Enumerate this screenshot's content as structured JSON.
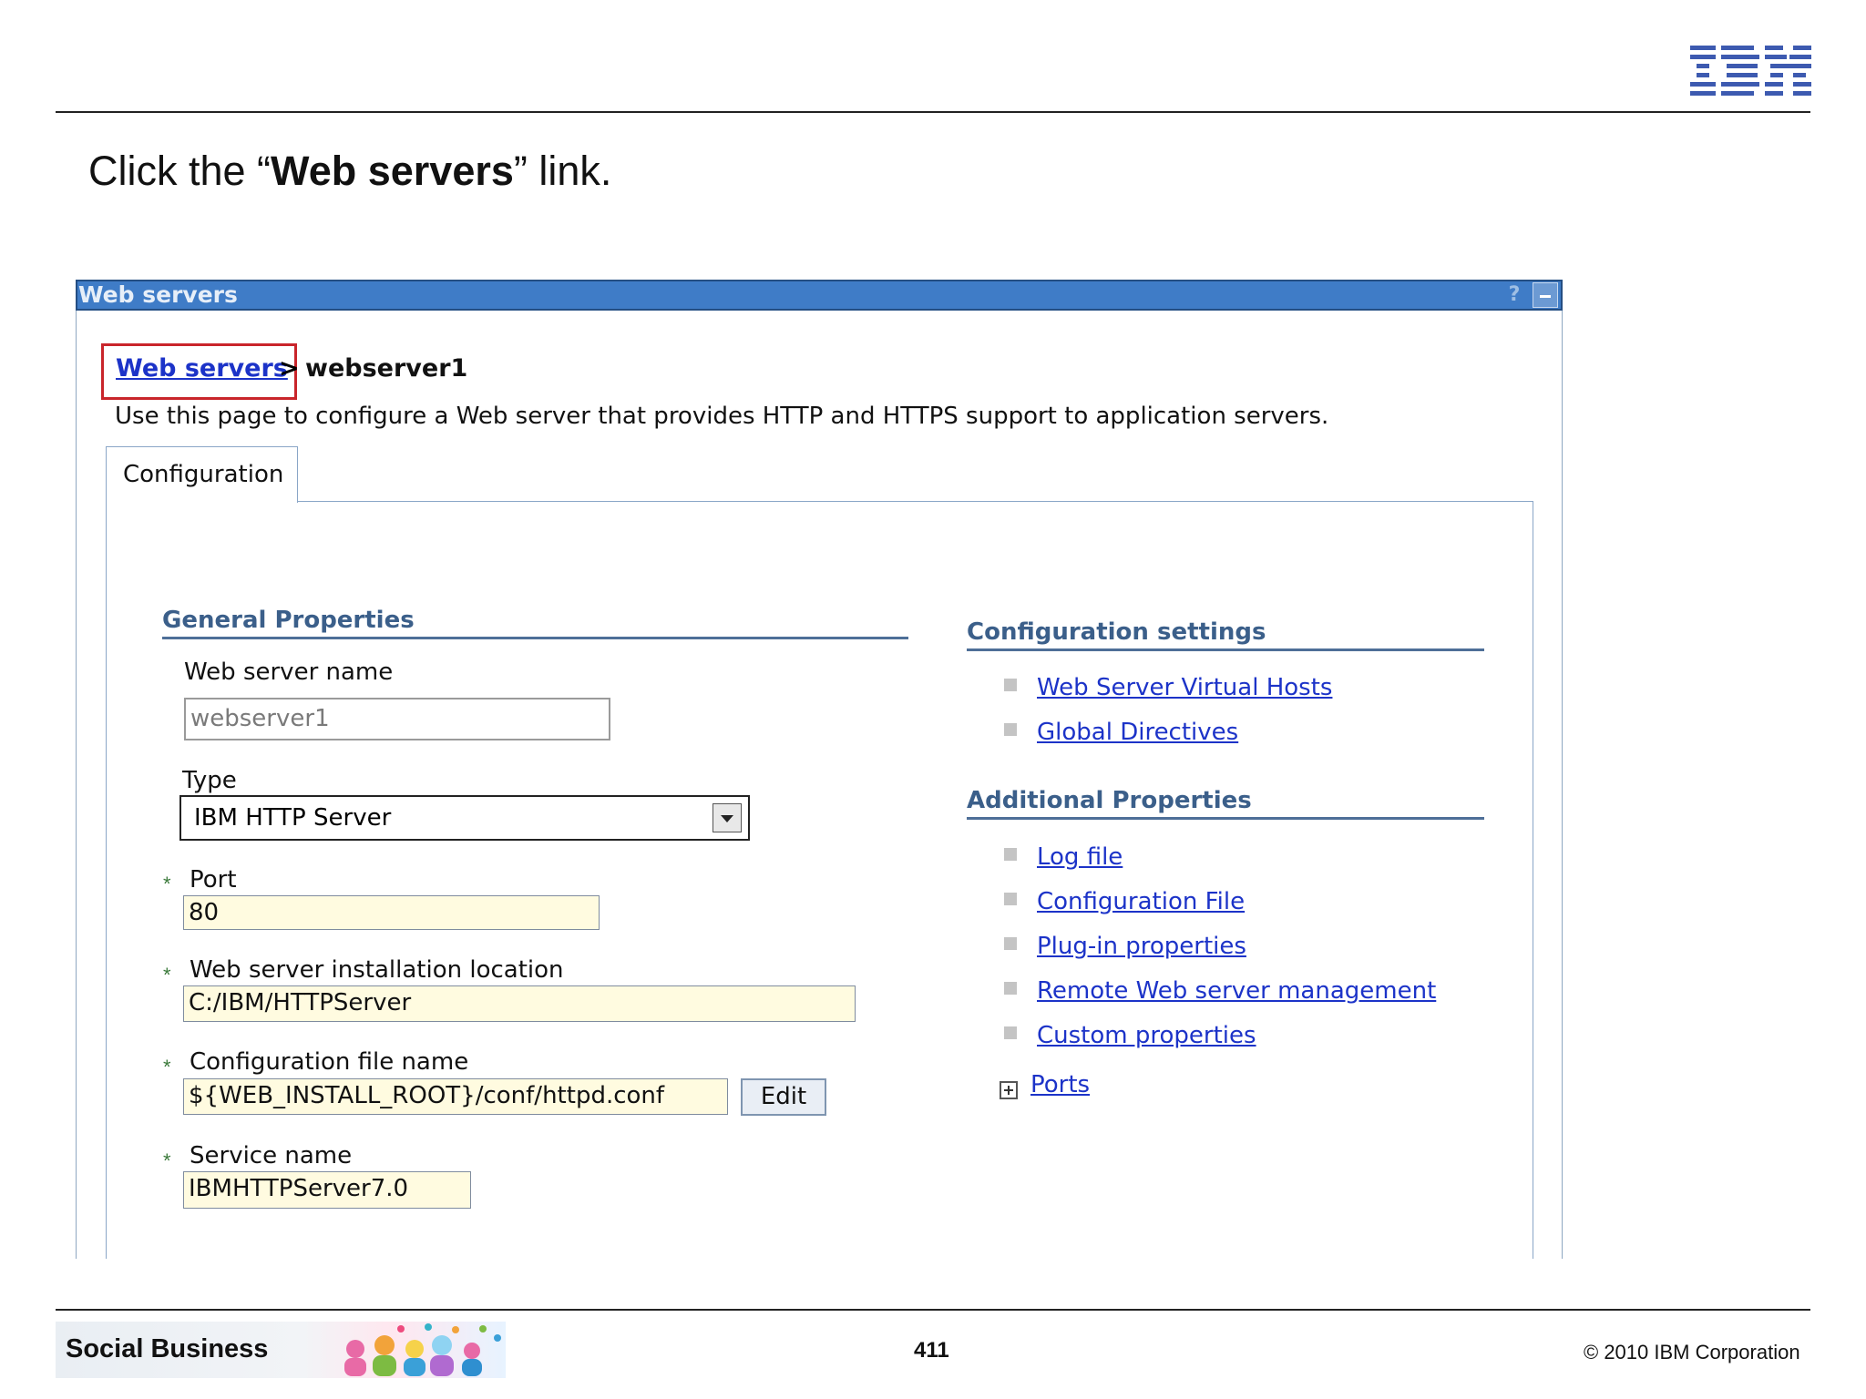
{
  "slide": {
    "logo": "IBM",
    "instruction_prefix": "Click the “",
    "instruction_bold": "Web servers",
    "instruction_suffix": "” link."
  },
  "panel": {
    "title": "Web servers",
    "help_icon": "question-icon",
    "minimize_icon": "minimize-icon",
    "breadcrumb_link": "Web servers",
    "breadcrumb_separator": ">",
    "breadcrumb_current": "webserver1",
    "description": "Use this page to configure a Web server that provides HTTP and HTTPS support to application servers.",
    "tab_label": "Configuration"
  },
  "general": {
    "heading": "General Properties",
    "name_label": "Web server name",
    "name_value": "webserver1",
    "type_label": "Type",
    "type_value": "IBM HTTP Server",
    "port_label": "Port",
    "port_value": "80",
    "location_label": "Web server installation location",
    "location_value": "C:/IBM/HTTPServer",
    "config_label": "Configuration file name",
    "config_value": "${WEB_INSTALL_ROOT}/conf/httpd.conf",
    "edit_label": "Edit",
    "service_label": "Service name",
    "service_value": "IBMHTTPServer7.0",
    "required_marker": "*"
  },
  "config_settings": {
    "heading": "Configuration settings",
    "links": [
      "Web Server Virtual Hosts",
      "Global Directives"
    ]
  },
  "additional": {
    "heading": "Additional Properties",
    "links": [
      "Log file",
      "Configuration File",
      "Plug-in properties",
      "Remote Web server management",
      "Custom properties"
    ],
    "ports_link": "Ports"
  },
  "footer": {
    "brand": "Social Business",
    "page_number": "411",
    "copyright": "© 2010 IBM Corporation"
  },
  "colors": {
    "titlebar": "#3f7cc7",
    "link": "#1c33c8",
    "section_heading": "#3b5f8a",
    "highlight_box": "#c9252b",
    "required_field_bg": "#fffbe0"
  }
}
